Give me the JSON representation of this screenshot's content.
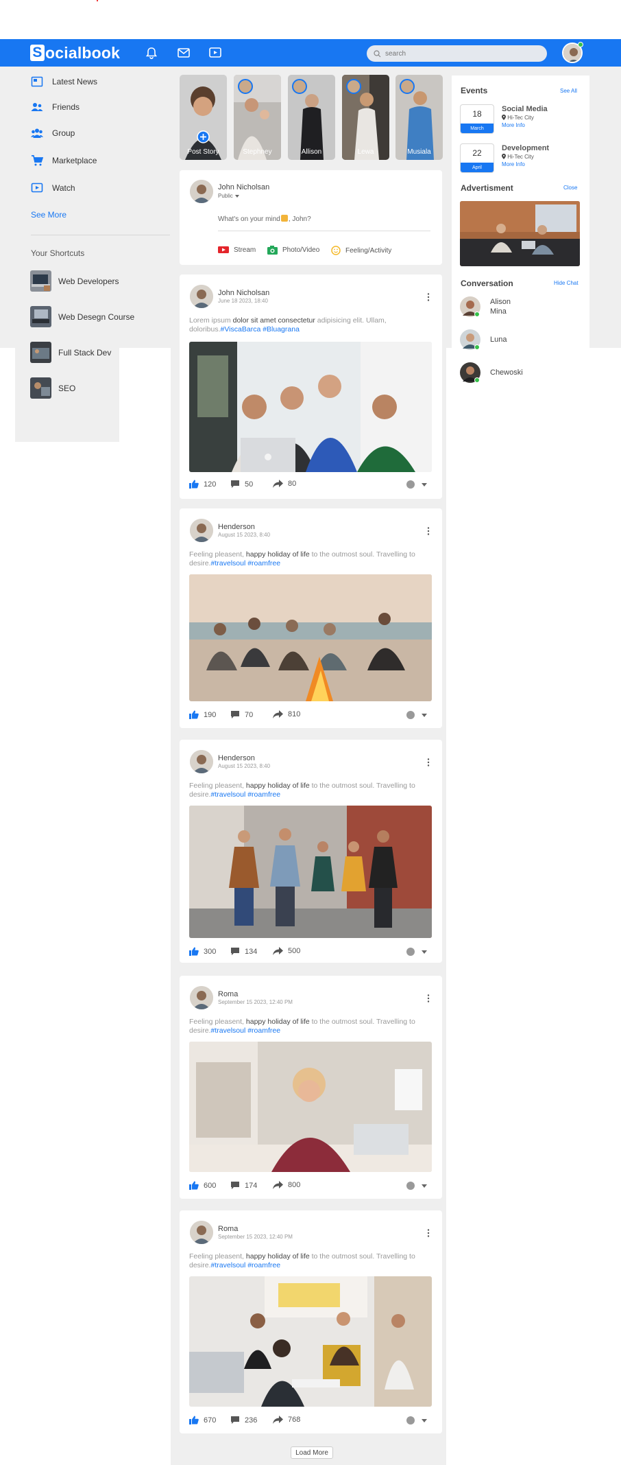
{
  "navbar": {
    "logo_letter": "S",
    "logo_rest": "ocialbook",
    "search_placeholder": "search",
    "icons": [
      "bell-icon",
      "mail-icon",
      "video-icon"
    ]
  },
  "sidebar": {
    "items": [
      {
        "label": "Latest News",
        "icon": "news-icon"
      },
      {
        "label": "Friends",
        "icon": "friends-icon"
      },
      {
        "label": "Group",
        "icon": "group-icon"
      },
      {
        "label": "Marketplace",
        "icon": "cart-icon"
      },
      {
        "label": "Watch",
        "icon": "watch-icon"
      }
    ],
    "see_more": "See More",
    "shortcuts_title": "Your Shortcuts",
    "shortcuts": [
      "Web Developers",
      "Web Desegn Course",
      "Full Stack Dev",
      "SEO"
    ]
  },
  "stories": [
    "Post Story",
    "Stephney",
    "Allison",
    "Lewa",
    "Musiala"
  ],
  "composer": {
    "name": "John Nicholsan",
    "privacy": "Public",
    "placeholder": "What's on your mind",
    "placeholder_end": ", John?",
    "actions": [
      "Stream",
      "Photo/Video",
      "Feeling/Activity"
    ]
  },
  "posts": [
    {
      "name": "John Nicholsan",
      "date": "June 18 2023, 18:40",
      "text_a": "Lorem ipsum ",
      "text_b": "dolor sit amet consectetur",
      "text_c": " adipisicing elit. Ullam, doloribus.",
      "tags": "#ViscaBarca #Bluagrana",
      "likes": "120",
      "comments": "50",
      "shares": "80"
    },
    {
      "name": "Henderson",
      "date": "August 15 2023, 8:40",
      "text_a": "Feeling pleasent, ",
      "text_b": "happy holiday of life",
      "text_c": " to the outmost soul. Travelling to desire.",
      "tags": "#travelsoul #roamfree",
      "likes": "190",
      "comments": "70",
      "shares": "810"
    },
    {
      "name": "Henderson",
      "date": "August 15 2023, 8:40",
      "text_a": "Feeling pleasent, ",
      "text_b": "happy holiday of life",
      "text_c": " to the outmost soul. Travelling to desire.",
      "tags": "#travelsoul #roamfree",
      "likes": "300",
      "comments": "134",
      "shares": "500"
    },
    {
      "name": "Roma",
      "date": "September 15 2023, 12:40 PM",
      "text_a": "Feeling pleasent, ",
      "text_b": "happy holiday of life",
      "text_c": " to the outmost soul. Travelling to desire.",
      "tags": "#travelsoul #roamfree",
      "likes": "600",
      "comments": "174",
      "shares": "800"
    },
    {
      "name": "Roma",
      "date": "September 15 2023, 12:40 PM",
      "text_a": "Feeling pleasent, ",
      "text_b": "happy holiday of life",
      "text_c": " to the outmost soul. Travelling to desire.",
      "tags": "#travelsoul #roamfree",
      "likes": "670",
      "comments": "236",
      "shares": "768"
    }
  ],
  "load_more": "Load More",
  "right": {
    "events_title": "Events",
    "see_all": "See All",
    "events": [
      {
        "day": "18",
        "month": "March",
        "title": "Social Media",
        "location": "Hi-Tec City",
        "more": "More Info"
      },
      {
        "day": "22",
        "month": "April",
        "title": "Development",
        "location": "Hi-Tec City",
        "more": "More Info"
      }
    ],
    "ad_title": "Advertisment",
    "ad_close": "Close",
    "conv_title": "Conversation",
    "hide_chat": "Hide Chat",
    "conversations": [
      "Alison Mina",
      "Luna",
      "Chewoski"
    ]
  },
  "colors": {
    "brand": "#1877f2",
    "online": "#36c04a"
  }
}
